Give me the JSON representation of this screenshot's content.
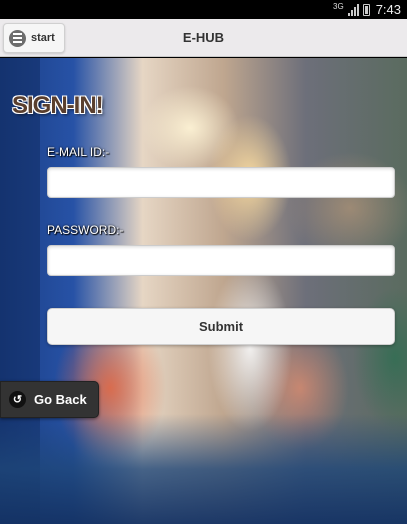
{
  "status_bar": {
    "network": "3G",
    "time": "7:43"
  },
  "header": {
    "start_label": "start",
    "title": "E-HUB"
  },
  "form": {
    "heading": "SIGN-IN!",
    "email_label": "E-MAIL ID:-",
    "email_value": "",
    "password_label": "PASSWORD:-",
    "password_value": "",
    "submit_label": "Submit"
  },
  "nav": {
    "go_back_label": "Go Back"
  },
  "icons": {
    "menu": "menu-icon",
    "back": "back-arrow-icon",
    "signal": "signal-icon",
    "battery": "battery-icon"
  }
}
